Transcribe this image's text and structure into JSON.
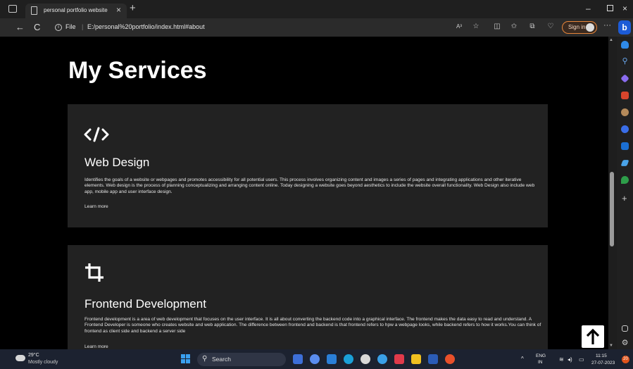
{
  "browser": {
    "tab_title": "personal portfolio website",
    "tab_close": "×",
    "new_tab": "+",
    "minimize": "–",
    "close": "×",
    "back": "←",
    "refresh": "C",
    "info": "i",
    "file_label": "File",
    "separator": "|",
    "url": "E:/personal%20portfolio/index.html#about",
    "read_aloud": "A³",
    "sign_in": "Sign in",
    "more": "···",
    "bing": "b"
  },
  "page": {
    "heading": "My Services",
    "services": [
      {
        "icon": "code-icon",
        "icon_text": "</>",
        "title": "Web Design",
        "description": "Identifies the goals of a website or webpages and promotes accessibility for all potential users. This process involves organizing content and images a series of pages and integrating applications and other iterative elements. Web design is the process of planning conceptualizing and arranging content online. Today designing a website goes beyond aesthetics to include the website overall functionality. Web Design also include web app, mobile app and user interface design.",
        "link": "Learn more"
      },
      {
        "icon": "crop-icon",
        "title": "Frontend Development",
        "description": "Frontend development is a area of web development that focuses on the user interface. It is all about converting the backend code into a graphical interface. The frontend makes the data easy to read and understand. A Frontend Developer is someone who creates website and web application. The difference between frontend and backend is that frontend refers to hpw a webpage looks, while backend refers to how it works.You can think of frontend as client side and backend a server side",
        "link": "Learn more"
      }
    ],
    "back_to_top_icon": "arrow-up-icon"
  },
  "taskbar": {
    "weather_temp": "29°C",
    "weather_desc": "Mostly cloudy",
    "search_label": "Search",
    "search_glyph": "⚲",
    "tray_chevron": "^",
    "language_top": "ENG",
    "language_bottom": "IN",
    "time": "11:15",
    "date": "27-07-2023",
    "notification_count": "20"
  },
  "colors": {
    "page_bg": "#000000",
    "card_bg": "#222222",
    "text": "#ffffff",
    "signin_accent": "#e8863a",
    "bing_blue": "#1c5bd6"
  }
}
